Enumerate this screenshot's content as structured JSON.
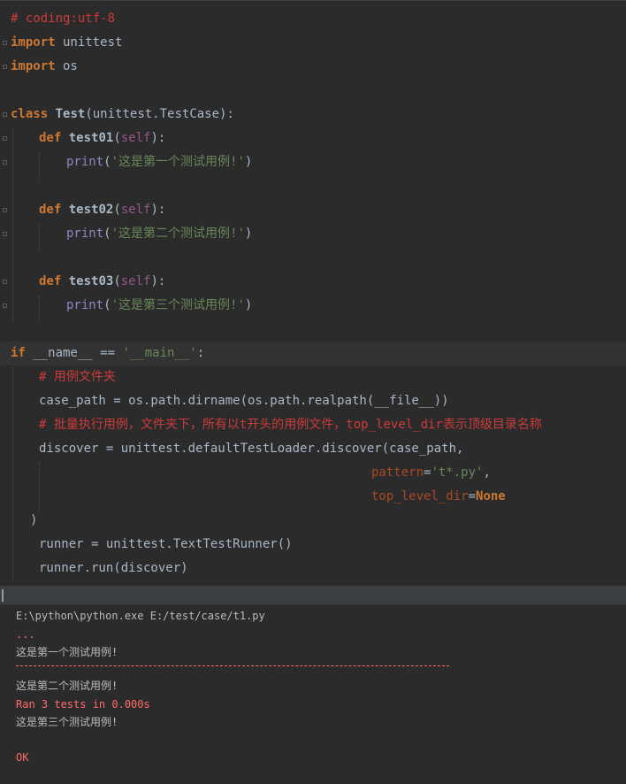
{
  "editor": {
    "line_coding": "# coding:utf-8",
    "line_import1_kw": "import",
    "line_import1_mod": " unittest",
    "line_import2_kw": "import",
    "line_import2_mod": " os",
    "class_kw": "class",
    "class_name": "Test",
    "class_base": "(unittest.TestCase):",
    "def_kw": "def",
    "m1_name": "test01",
    "m2_name": "test02",
    "m3_name": "test03",
    "self_word": "self",
    "paren_open": "(",
    "paren_close_colon": "):",
    "print_word": "print",
    "print1_str": "'这是第一个测试用例!'",
    "print2_str": "'这是第二个测试用例!'",
    "print3_str": "'这是第三个测试用例!'",
    "if_kw": "if",
    "dunder_name": " __name__ == ",
    "main_str": "'__main__'",
    "colon": ":",
    "comment1": "# 用例文件夹",
    "case_path_line": "case_path = os.path.dirname(os.path.realpath(__file__))",
    "comment2": "# 批量执行用例，文件夹下，所有以t开头的用例文件，top_level_dir表示顶级目录名称",
    "discover_line": "discover = unittest.defaultTestLoader.discover(case_path,",
    "pattern_kw": "pattern",
    "eq": "=",
    "pattern_str": "'t*.py'",
    "comma": ",",
    "toplevel_kw": "top_level_dir",
    "none_kw": "None",
    "close_paren": ")",
    "runner_line": "runner = unittest.TextTestRunner()",
    "run_line": "runner.run(discover)"
  },
  "console": {
    "cmd": "E:\\python\\python.exe E:/test/case/t1.py",
    "dots": "...",
    "out1": "这是第一个测试用例!",
    "out2": "这是第二个测试用例!",
    "ran": "Ran 3 tests in 0.000s",
    "out3": "这是第三个测试用例!",
    "ok": "OK"
  },
  "colors": {
    "background": "#2b2b2b",
    "keyword": "#cc7832",
    "string": "#6a8759",
    "comment": "#cc3b3b",
    "self": "#94558d",
    "function": "#ffc66d",
    "stderr": "#ff6b68"
  }
}
